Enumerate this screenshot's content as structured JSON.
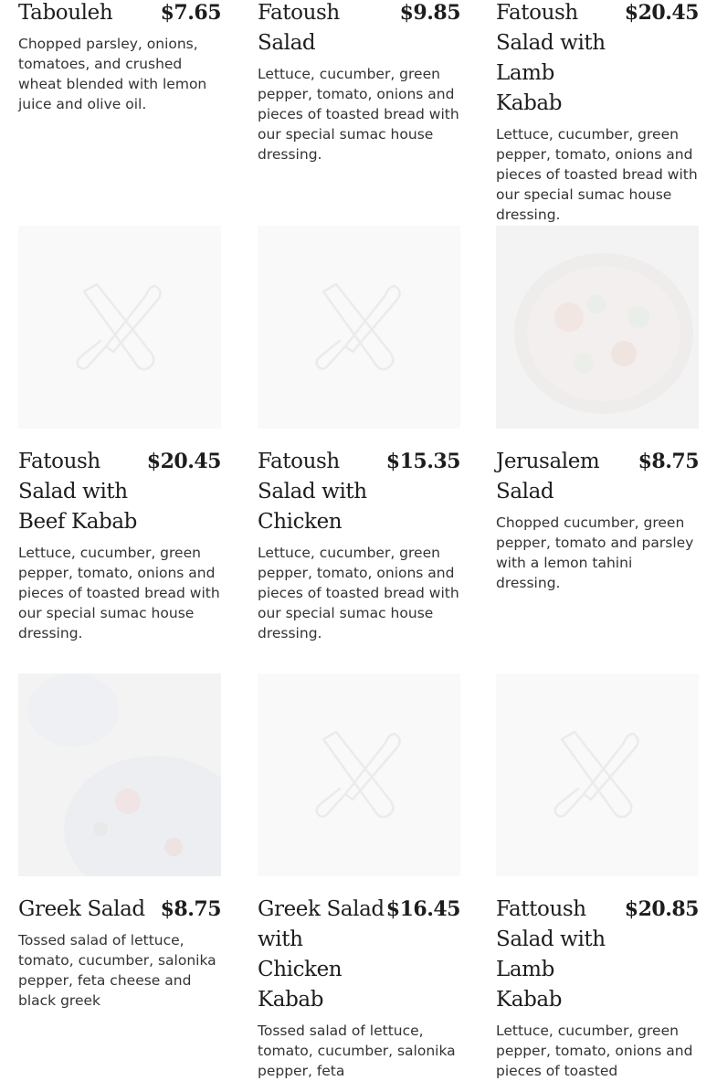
{
  "menu": {
    "items": [
      {
        "name": "Tabouleh",
        "price": "$7.65",
        "description": "Chopped parsley, onions, tomatoes, and crushed wheat blended with lemon juice and olive oil.",
        "image": "none"
      },
      {
        "name": "Fatoush Salad",
        "price": "$9.85",
        "description": "Lettuce, cucumber, green pepper, tomato, onions and pieces of toasted bread with our special sumac house dressing.",
        "image": "none"
      },
      {
        "name": "Fatoush Salad with Lamb Kabab",
        "price": "$20.45",
        "description": "Lettuce, cucumber, green pepper, tomato, onions and pieces of toasted bread with our special sumac house dressing.",
        "image": "none"
      },
      {
        "name": "Fatoush Salad with Beef Kabab",
        "price": "$20.45",
        "description": "Lettuce, cucumber, green pepper, tomato, onions and pieces of toasted bread with our special sumac house dressing.",
        "image": "fork-knife-placeholder-icon"
      },
      {
        "name": "Fatoush Salad with Chicken",
        "price": "$15.35",
        "description": "Lettuce, cucumber, green pepper, tomato, onions and pieces of toasted bread with our special sumac house dressing.",
        "image": "fork-knife-placeholder-icon"
      },
      {
        "name": "Jerusalem Salad",
        "price": "$8.75",
        "description": "Chopped cucumber, green pepper, tomato and parsley with a lemon tahini dressing.",
        "image": "salad-bowl-photo"
      },
      {
        "name": "Greek Salad",
        "price": "$8.75",
        "description": "Tossed salad of lettuce, tomato, cucumber, salonika pepper, feta cheese and black greek",
        "image": "salad-plate-photo"
      },
      {
        "name": "Greek Salad with Chicken Kabab",
        "price": "$16.45",
        "description": "Tossed salad of lettuce, tomato, cucumber, salonika pepper, feta",
        "image": "fork-knife-placeholder-icon"
      },
      {
        "name": "Fattoush Salad with Lamb Kabab",
        "price": "$20.85",
        "description": "Lettuce, cucumber, green pepper, tomato, onions and pieces of toasted",
        "image": "fork-knife-placeholder-icon"
      }
    ]
  },
  "colors": {
    "text": "#1d1d1d",
    "description": "#333333",
    "placeholder_bg": "#f9f9f9",
    "placeholder_icon": "#ebebeb"
  }
}
